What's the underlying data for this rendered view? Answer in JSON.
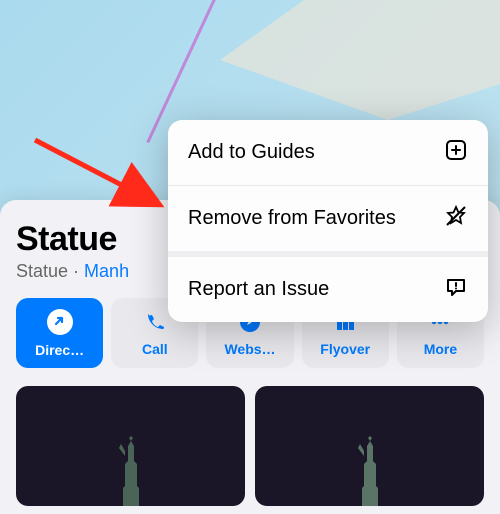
{
  "place": {
    "title": "Statue",
    "category": "Statue",
    "separator": " · ",
    "locality": "Manh"
  },
  "actions": {
    "directions": "Direc…",
    "call": "Call",
    "website": "Webs…",
    "flyover": "Flyover",
    "more": "More"
  },
  "menu": {
    "add_to_guides": "Add to Guides",
    "remove_favorites": "Remove from Favorites",
    "report_issue": "Report an Issue"
  },
  "colors": {
    "accent": "#007aff",
    "arrow": "#ff2a1a"
  }
}
